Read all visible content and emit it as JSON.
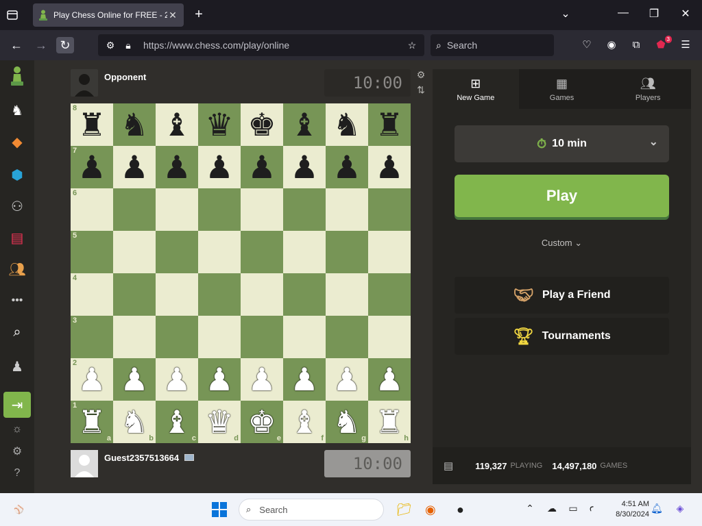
{
  "browser": {
    "tab_title": "Play Chess Online for FREE - 2",
    "url": "https://www.chess.com/play/online",
    "search_placeholder": "Search",
    "notification_badge": "3"
  },
  "game": {
    "opponent_name": "Opponent",
    "opponent_clock": "10:00",
    "player_name": "Guest2357513664",
    "player_clock": "10:00",
    "ranks": [
      "8",
      "7",
      "6",
      "5",
      "4",
      "3",
      "2",
      "1"
    ],
    "files": [
      "a",
      "b",
      "c",
      "d",
      "e",
      "f",
      "g",
      "h"
    ],
    "board": [
      [
        "br",
        "bn",
        "bb",
        "bq",
        "bk",
        "bb",
        "bn",
        "br"
      ],
      [
        "bp",
        "bp",
        "bp",
        "bp",
        "bp",
        "bp",
        "bp",
        "bp"
      ],
      [
        "",
        "",
        "",
        "",
        "",
        "",
        "",
        ""
      ],
      [
        "",
        "",
        "",
        "",
        "",
        "",
        "",
        ""
      ],
      [
        "",
        "",
        "",
        "",
        "",
        "",
        "",
        ""
      ],
      [
        "",
        "",
        "",
        "",
        "",
        "",
        "",
        ""
      ],
      [
        "wp",
        "wp",
        "wp",
        "wp",
        "wp",
        "wp",
        "wp",
        "wp"
      ],
      [
        "wr",
        "wn",
        "wb",
        "wq",
        "wk",
        "wb",
        "wn",
        "wr"
      ]
    ]
  },
  "panel": {
    "tabs": [
      {
        "label": "New Game",
        "icon": "plus-square-icon"
      },
      {
        "label": "Games",
        "icon": "checker-icon"
      },
      {
        "label": "Players",
        "icon": "people-icon"
      }
    ],
    "time_control": "10 min",
    "play_label": "Play",
    "custom_label": "Custom",
    "play_friend_label": "Play a Friend",
    "tournaments_label": "Tournaments",
    "playing_count": "119,327",
    "playing_label": "PLAYING",
    "games_count": "14,497,180",
    "games_label": "GAMES"
  },
  "taskbar": {
    "search_placeholder": "Search",
    "time": "4:51 AM",
    "date": "8/30/2024"
  },
  "colors": {
    "board_light": "#ebecd0",
    "board_dark": "#779556",
    "accent_green": "#81b64c"
  }
}
